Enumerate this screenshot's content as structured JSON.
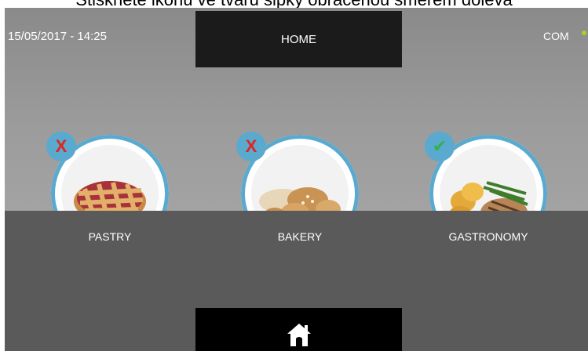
{
  "caption": "Stiskněte ikonu ve tvaru šipky obrácenou směrem doleva",
  "header": {
    "datetime": "15/05/2017 - 14:25",
    "title": "HOME",
    "com_label": "COM",
    "com_status_color": "#a6d321"
  },
  "categories": [
    {
      "label": "PASTRY",
      "status": "disabled",
      "badge_icon": "x-icon",
      "image": "pie-icon"
    },
    {
      "label": "BAKERY",
      "status": "disabled",
      "badge_icon": "x-icon",
      "image": "bread-icon"
    },
    {
      "label": "GASTRONOMY",
      "status": "enabled",
      "badge_icon": "check-icon",
      "image": "steak-icon"
    }
  ],
  "footer": {
    "home_icon": "home-icon"
  },
  "colors": {
    "accent": "#5aa9cf",
    "x": "#e0261f",
    "check": "#2fb34a"
  }
}
